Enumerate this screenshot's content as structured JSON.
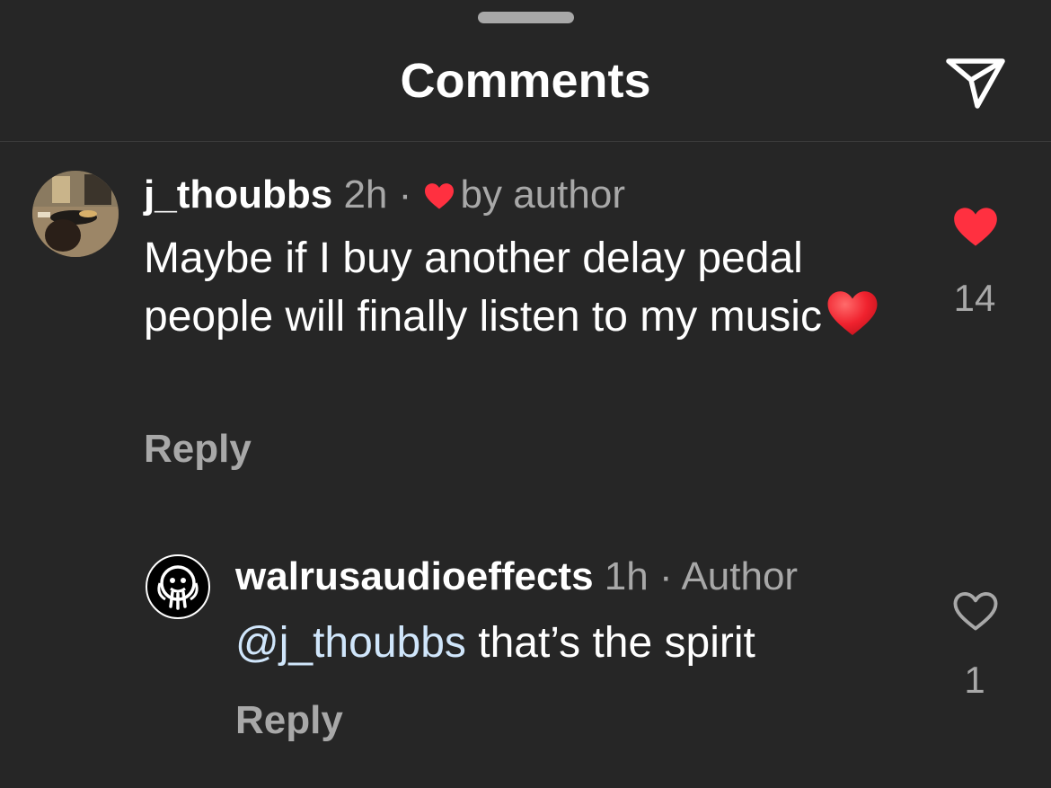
{
  "header": {
    "title": "Comments",
    "share_icon": "paper-plane-icon"
  },
  "colors": {
    "background": "#262626",
    "primary_text": "#ffffff",
    "secondary_text": "#a8a8a8",
    "mention": "#d0e6fb",
    "like_red": "#ff3040"
  },
  "comments": [
    {
      "username": "j_thoubbs",
      "time": "2h",
      "separator": "·",
      "badge": "by author",
      "badge_icon": "heart-icon",
      "text": "Maybe if I buy another delay pedal people will finally listen to my music",
      "emoji": "red-heart-emoji",
      "reply_label": "Reply",
      "like_icon": "heart-filled-icon",
      "liked": true,
      "like_count": "14"
    },
    {
      "username": "walrusaudioeffects",
      "time": "1h",
      "separator": "·",
      "badge": "Author",
      "mention": "@j_thoubbs",
      "text": " that’s the spirit",
      "reply_label": "Reply",
      "like_icon": "heart-outline-icon",
      "liked": false,
      "like_count": "1"
    }
  ]
}
